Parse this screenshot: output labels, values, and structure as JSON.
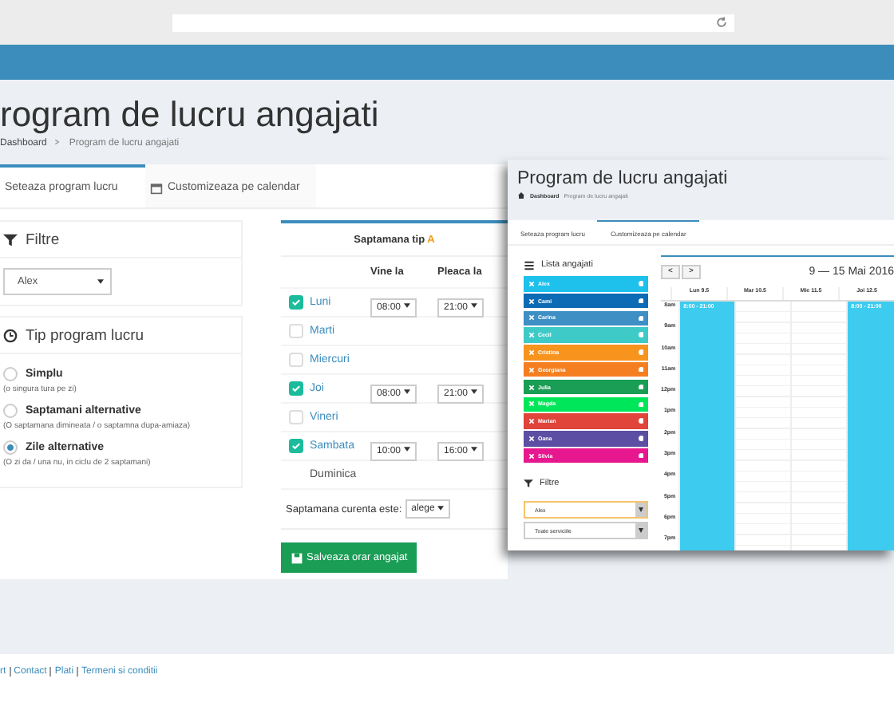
{
  "page": {
    "title": "rogram de lucru angajati",
    "breadcrumb": [
      "Dashboard",
      "Program de lucru angajati"
    ]
  },
  "tabs": [
    {
      "label": "Seteaza program lucru",
      "selected": true
    },
    {
      "label": "Customizeaza pe calendar",
      "selected": false
    }
  ],
  "filters": {
    "title": "Filtre",
    "employee": "Alex"
  },
  "program_type": {
    "title": "Tip program lucru",
    "options": [
      {
        "label": "Simplu",
        "hint": "(o singura tura pe zi)",
        "selected": false
      },
      {
        "label": "Saptamani alternative",
        "hint": "(O saptamana dimineata / o saptamna dupa-amiaza)",
        "selected": false
      },
      {
        "label": "Zile alternative",
        "hint": "(O zi da / una nu, in ciclu de 2 saptamani)",
        "selected": true
      }
    ]
  },
  "week": {
    "title": "Saptamana tip",
    "letter": "A",
    "col_in": "Vine la",
    "col_out": "Pleaca la",
    "days": [
      {
        "name": "Luni",
        "checked": true,
        "in": "08:00",
        "out": "21:00"
      },
      {
        "name": "Marti",
        "checked": false
      },
      {
        "name": "Miercuri",
        "checked": false
      },
      {
        "name": "Joi",
        "checked": true,
        "in": "08:00",
        "out": "21:00"
      },
      {
        "name": "Vineri",
        "checked": false
      },
      {
        "name": "Sambata",
        "checked": true,
        "in": "10:00",
        "out": "16:00"
      },
      {
        "name": "Duminica"
      }
    ],
    "current_label": "Saptamana curenta este:",
    "current_value": "alege",
    "save": "Salveaza orar angajat"
  },
  "inset": {
    "title": "Program de lucru angajati",
    "breadcrumb": [
      "Dashboard",
      "Program de lucru angajati"
    ],
    "tabs": [
      {
        "label": "Seteaza program lucru",
        "selected": false
      },
      {
        "label": "Customizeaza pe calendar",
        "selected": true
      }
    ],
    "list_title": "Lista angajati",
    "employees": [
      {
        "name": "Alex",
        "color": "#1ec0ec"
      },
      {
        "name": "Cami",
        "color": "#0d6bb5"
      },
      {
        "name": "Carina",
        "color": "#3d8fc4"
      },
      {
        "name": "Cecil",
        "color": "#3ecbc8"
      },
      {
        "name": "Cristina",
        "color": "#f7941d"
      },
      {
        "name": "Georgiana",
        "color": "#f57f20"
      },
      {
        "name": "Julia",
        "color": "#1a9d55"
      },
      {
        "name": "Magda",
        "color": "#00e65a"
      },
      {
        "name": "Marian",
        "color": "#e0443a"
      },
      {
        "name": "Oana",
        "color": "#5b4ea3"
      },
      {
        "name": "Silvia",
        "color": "#e6178f"
      }
    ],
    "filter_title": "Filtre",
    "filter_values": [
      "Alex",
      "Toate serviciile"
    ],
    "prev": "<",
    "next": ">",
    "range": "9 — 15 Mai 2016",
    "columns": [
      {
        "label": "Lun 9.5",
        "event": "8:00 - 21:00"
      },
      {
        "label": "Mar 10.5"
      },
      {
        "label": "Mie 11.5"
      },
      {
        "label": "Joi 12.5",
        "event": "8:00 - 21:00"
      }
    ],
    "times": [
      "8am",
      "9am",
      "10am",
      "11am",
      "12pm",
      "1pm",
      "2pm",
      "3pm",
      "4pm",
      "5pm",
      "6pm",
      "7pm"
    ]
  },
  "footer": [
    "rt",
    "Contact",
    "Plati",
    "Termeni si conditii"
  ]
}
